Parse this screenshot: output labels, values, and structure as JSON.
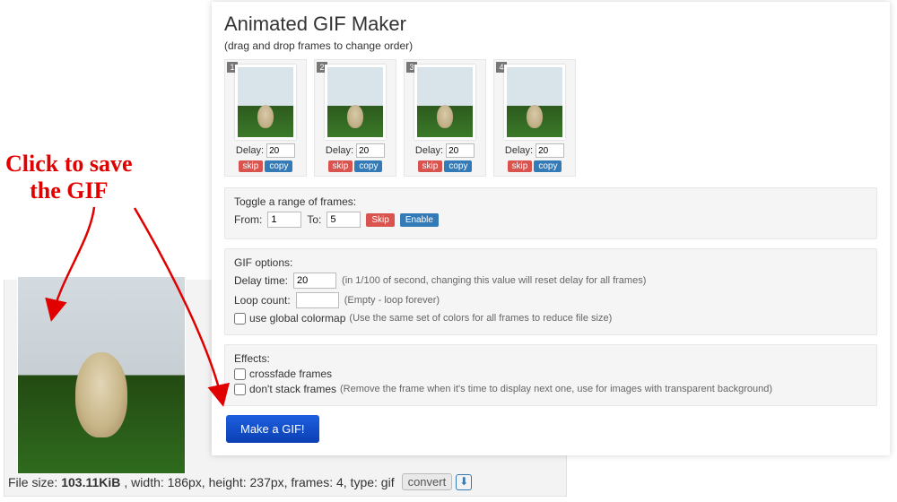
{
  "annotation": {
    "line1": "Click to save",
    "line2": "the GIF"
  },
  "card": {
    "title": "Animated GIF Maker",
    "subtitle": "(drag and drop frames to change order)",
    "frames": [
      {
        "num": "1",
        "delay_label": "Delay:",
        "delay": "20",
        "skip": "skip",
        "copy": "copy"
      },
      {
        "num": "2",
        "delay_label": "Delay:",
        "delay": "20",
        "skip": "skip",
        "copy": "copy"
      },
      {
        "num": "3",
        "delay_label": "Delay:",
        "delay": "20",
        "skip": "skip",
        "copy": "copy"
      },
      {
        "num": "4",
        "delay_label": "Delay:",
        "delay": "20",
        "skip": "skip",
        "copy": "copy"
      }
    ],
    "toggle": {
      "heading": "Toggle a range of frames:",
      "from_label": "From:",
      "from": "1",
      "to_label": "To:",
      "to": "5",
      "skip": "Skip",
      "enable": "Enable"
    },
    "options": {
      "heading": "GIF options:",
      "delay_label": "Delay time:",
      "delay": "20",
      "delay_hint": "(in 1/100 of second, changing this value will reset delay for all frames)",
      "loop_label": "Loop count:",
      "loop": "",
      "loop_hint": "(Empty - loop forever)",
      "colormap_label": "use global colormap",
      "colormap_hint": "(Use the same set of colors for all frames to reduce file size)"
    },
    "effects": {
      "heading": "Effects:",
      "crossfade": "crossfade frames",
      "dontstack": "don't stack frames",
      "dontstack_hint": "(Remove the frame when it's time to display next one, use for images with transparent background)"
    },
    "make_button": "Make a GIF!"
  },
  "preview": {
    "file_size_label": "File size: ",
    "file_size": "103.11KiB",
    "rest": ", width: 186px, height: 237px, frames: 4, type: gif",
    "convert": "convert"
  }
}
